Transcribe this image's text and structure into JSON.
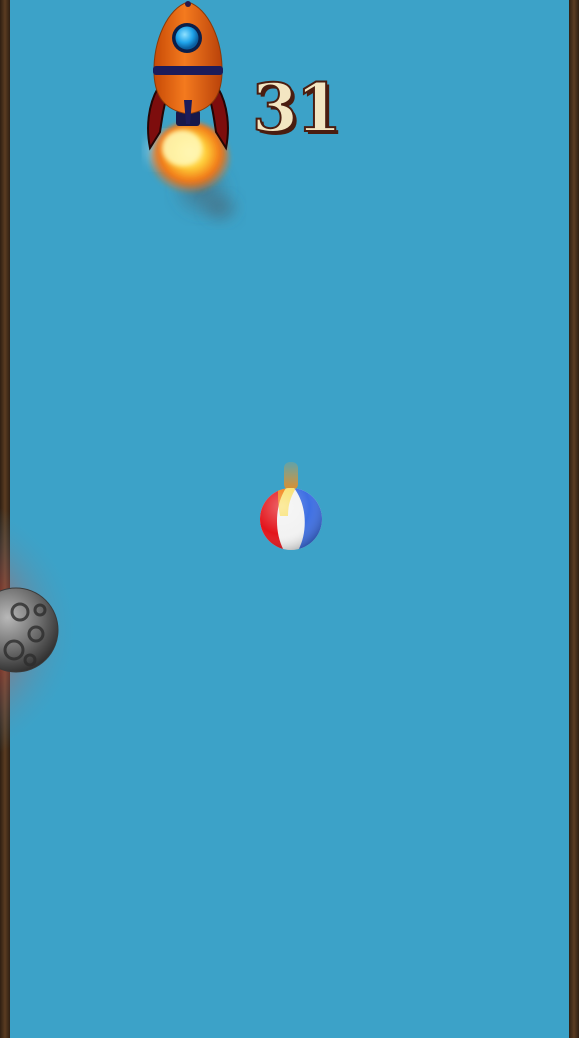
{
  "game": {
    "score": "31",
    "colors": {
      "background": "#3ca2c8",
      "wall": "#4a3320",
      "rocket_body": "#f06a12",
      "rocket_window": "#1fa3ea",
      "score_fill": "#f3e6c2",
      "score_outline": "#4a1d10"
    },
    "sprites": {
      "player": "rocket-icon",
      "thrust": "flame-icon",
      "pickup": "beach-ball-icon",
      "obstacle": "asteroid-icon"
    }
  }
}
